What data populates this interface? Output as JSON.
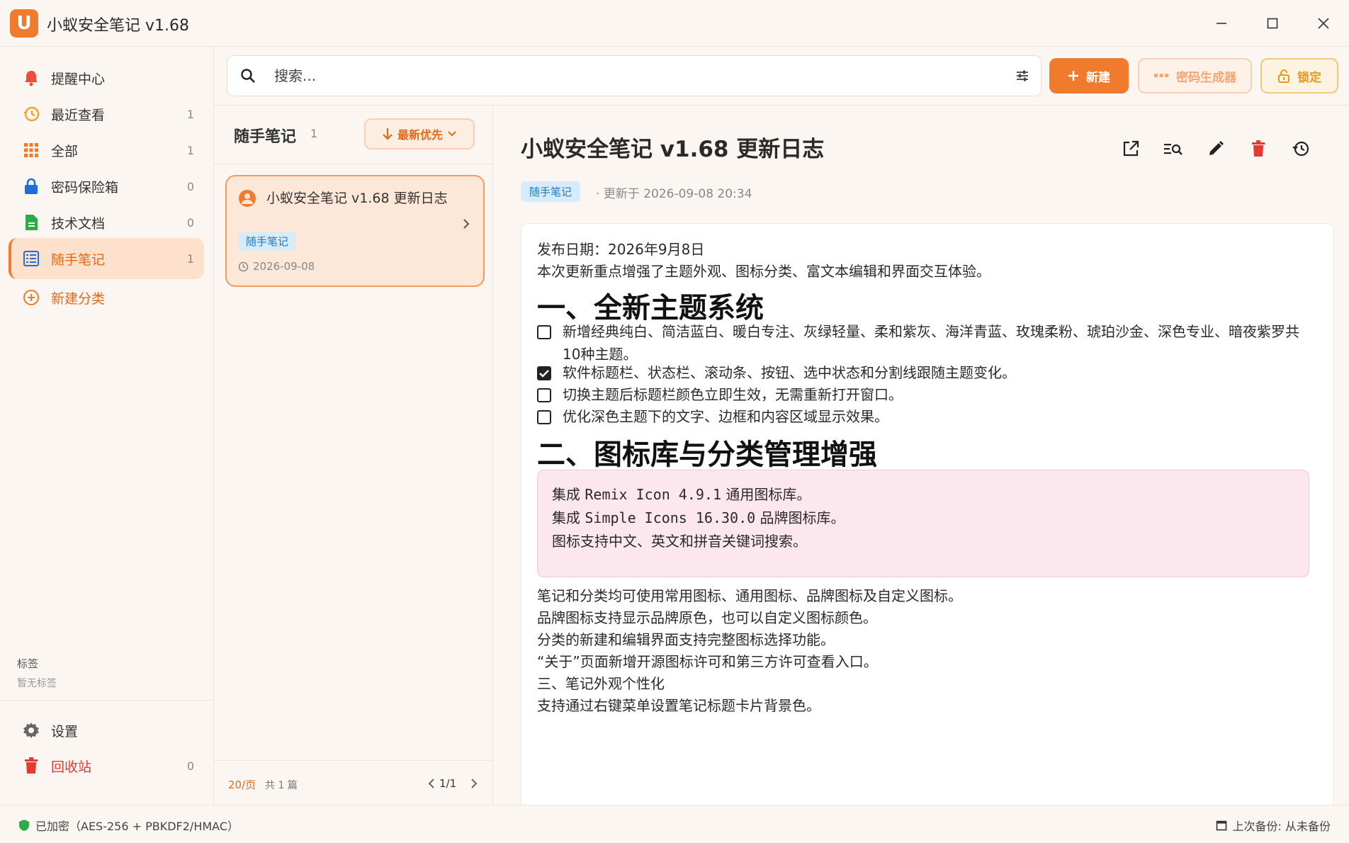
{
  "app": {
    "title": "小蚁安全笔记 v1.68",
    "logo": "U"
  },
  "sidebar": {
    "items": [
      {
        "label": "提醒中心",
        "count": ""
      },
      {
        "label": "最近查看",
        "count": "1"
      },
      {
        "label": "全部",
        "count": "1"
      },
      {
        "label": "密码保险箱",
        "count": "0"
      },
      {
        "label": "技术文档",
        "count": "0"
      },
      {
        "label": "随手笔记",
        "count": "1"
      },
      {
        "label": "新建分类",
        "count": ""
      }
    ],
    "tags_title": "标签",
    "tags_empty": "暂无标签",
    "settings": "设置",
    "trash": {
      "label": "回收站",
      "count": "0"
    }
  },
  "search": {
    "placeholder": "搜索..."
  },
  "toolbar": {
    "new_label": "新建",
    "password_gen_label": "密码生成器",
    "lock_label": "锁定"
  },
  "list": {
    "title": "随手笔记",
    "count": "1",
    "sort_label": "最新优先",
    "notes": [
      {
        "title": "小蚁安全笔记 v1.68 更新日志",
        "tag": "随手笔记",
        "date": "2026-09-08"
      }
    ],
    "per_page": "20/页",
    "total": "共 1 篇",
    "page": "1/1"
  },
  "detail": {
    "title": "小蚁安全笔记 v1.68 更新日志",
    "tag": "随手笔记",
    "updated": "· 更新于 2026-09-08 20:34",
    "release_date": "发布日期：2026年9月8日",
    "intro": "本次更新重点增强了主题外观、图标分类、富文本编辑和界面交互体验。",
    "h1_a": "一、全新主题系统",
    "checklist": [
      {
        "text": "新增经典纯白、简洁蓝白、暖白专注、灰绿轻量、柔和紫灰、海洋青蓝、玫瑰柔粉、琥珀沙金、深色专业、暗夜紫罗共10种主题。",
        "checked": false
      },
      {
        "text": "软件标题栏、状态栏、滚动条、按钮、选中状态和分割线跟随主题变化。",
        "checked": true
      },
      {
        "text": "切换主题后标题栏颜色立即生效，无需重新打开窗口。",
        "checked": false
      },
      {
        "text": "优化深色主题下的文字、边框和内容区域显示效果。",
        "checked": false
      }
    ],
    "h1_b": "二、图标库与分类管理增强",
    "quote": {
      "line1_pre": "集成 ",
      "line1_code": "Remix Icon 4.9.1",
      "line1_post": " 通用图标库。",
      "line2_pre": "集成 ",
      "line2_code": "Simple Icons 16.30.0",
      "line2_post": " 品牌图标库。",
      "line3": "图标支持中文、英文和拼音关键词搜索。"
    },
    "paras": [
      "笔记和分类均可使用常用图标、通用图标、品牌图标及自定义图标。",
      "品牌图标支持显示品牌原色，也可以自定义图标颜色。",
      "分类的新建和编辑界面支持完整图标选择功能。",
      "“关于”页面新增开源图标许可和第三方许可查看入口。",
      "三、笔记外观个性化",
      "支持通过右键菜单设置笔记标题卡片背景色。"
    ]
  },
  "status": {
    "encryption": "已加密（AES-256 + PBKDF2/HMAC）",
    "backup": "上次备份: 从未备份"
  },
  "colors": {
    "accent": "#f07b2c",
    "tag_bg": "#d7ebf9",
    "tag_fg": "#1f7bc0",
    "quote_bg": "#fde7ee"
  },
  "icons": [
    "bell-icon",
    "history-icon",
    "grid-icon",
    "lock-icon",
    "document-icon",
    "list-icon",
    "add-circle-icon",
    "gear-icon",
    "trash-icon",
    "search-icon",
    "filter-icon",
    "plus-icon",
    "dots-icon",
    "unlock-icon",
    "arrow-down-icon",
    "chevron-down-icon",
    "user-icon",
    "chevron-right-icon",
    "clock-icon",
    "external-link-icon",
    "find-in-text-icon",
    "pencil-icon",
    "delete-icon",
    "restore-icon",
    "shield-icon",
    "calendar-icon"
  ]
}
